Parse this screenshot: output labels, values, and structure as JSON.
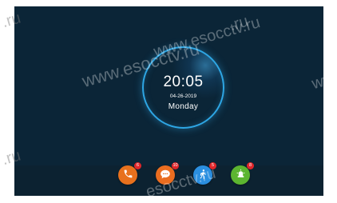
{
  "clock": {
    "time": "20:05",
    "date": "04-26-2019",
    "day": "Monday"
  },
  "dock": {
    "buttons": [
      {
        "name": "call",
        "icon": "phone-icon",
        "badge": "6",
        "color": "#e8711d"
      },
      {
        "name": "message",
        "icon": "message-icon",
        "badge": "10",
        "color": "#ea6d20"
      },
      {
        "name": "motion",
        "icon": "walking-person-icon",
        "badge": "5",
        "color": "#2b8fe0"
      },
      {
        "name": "alarm",
        "icon": "alarm-light-icon",
        "badge": "8",
        "color": "#5cb530"
      }
    ]
  },
  "watermarks": {
    "main": "www.esocctv.ru",
    "center": "www.esocctv.ru",
    "top_right": ".ru",
    "bottom_right": ".esocctv.ru",
    "left_top": ".ru",
    "left_bottom": ".ru",
    "right_edge": "ww"
  }
}
